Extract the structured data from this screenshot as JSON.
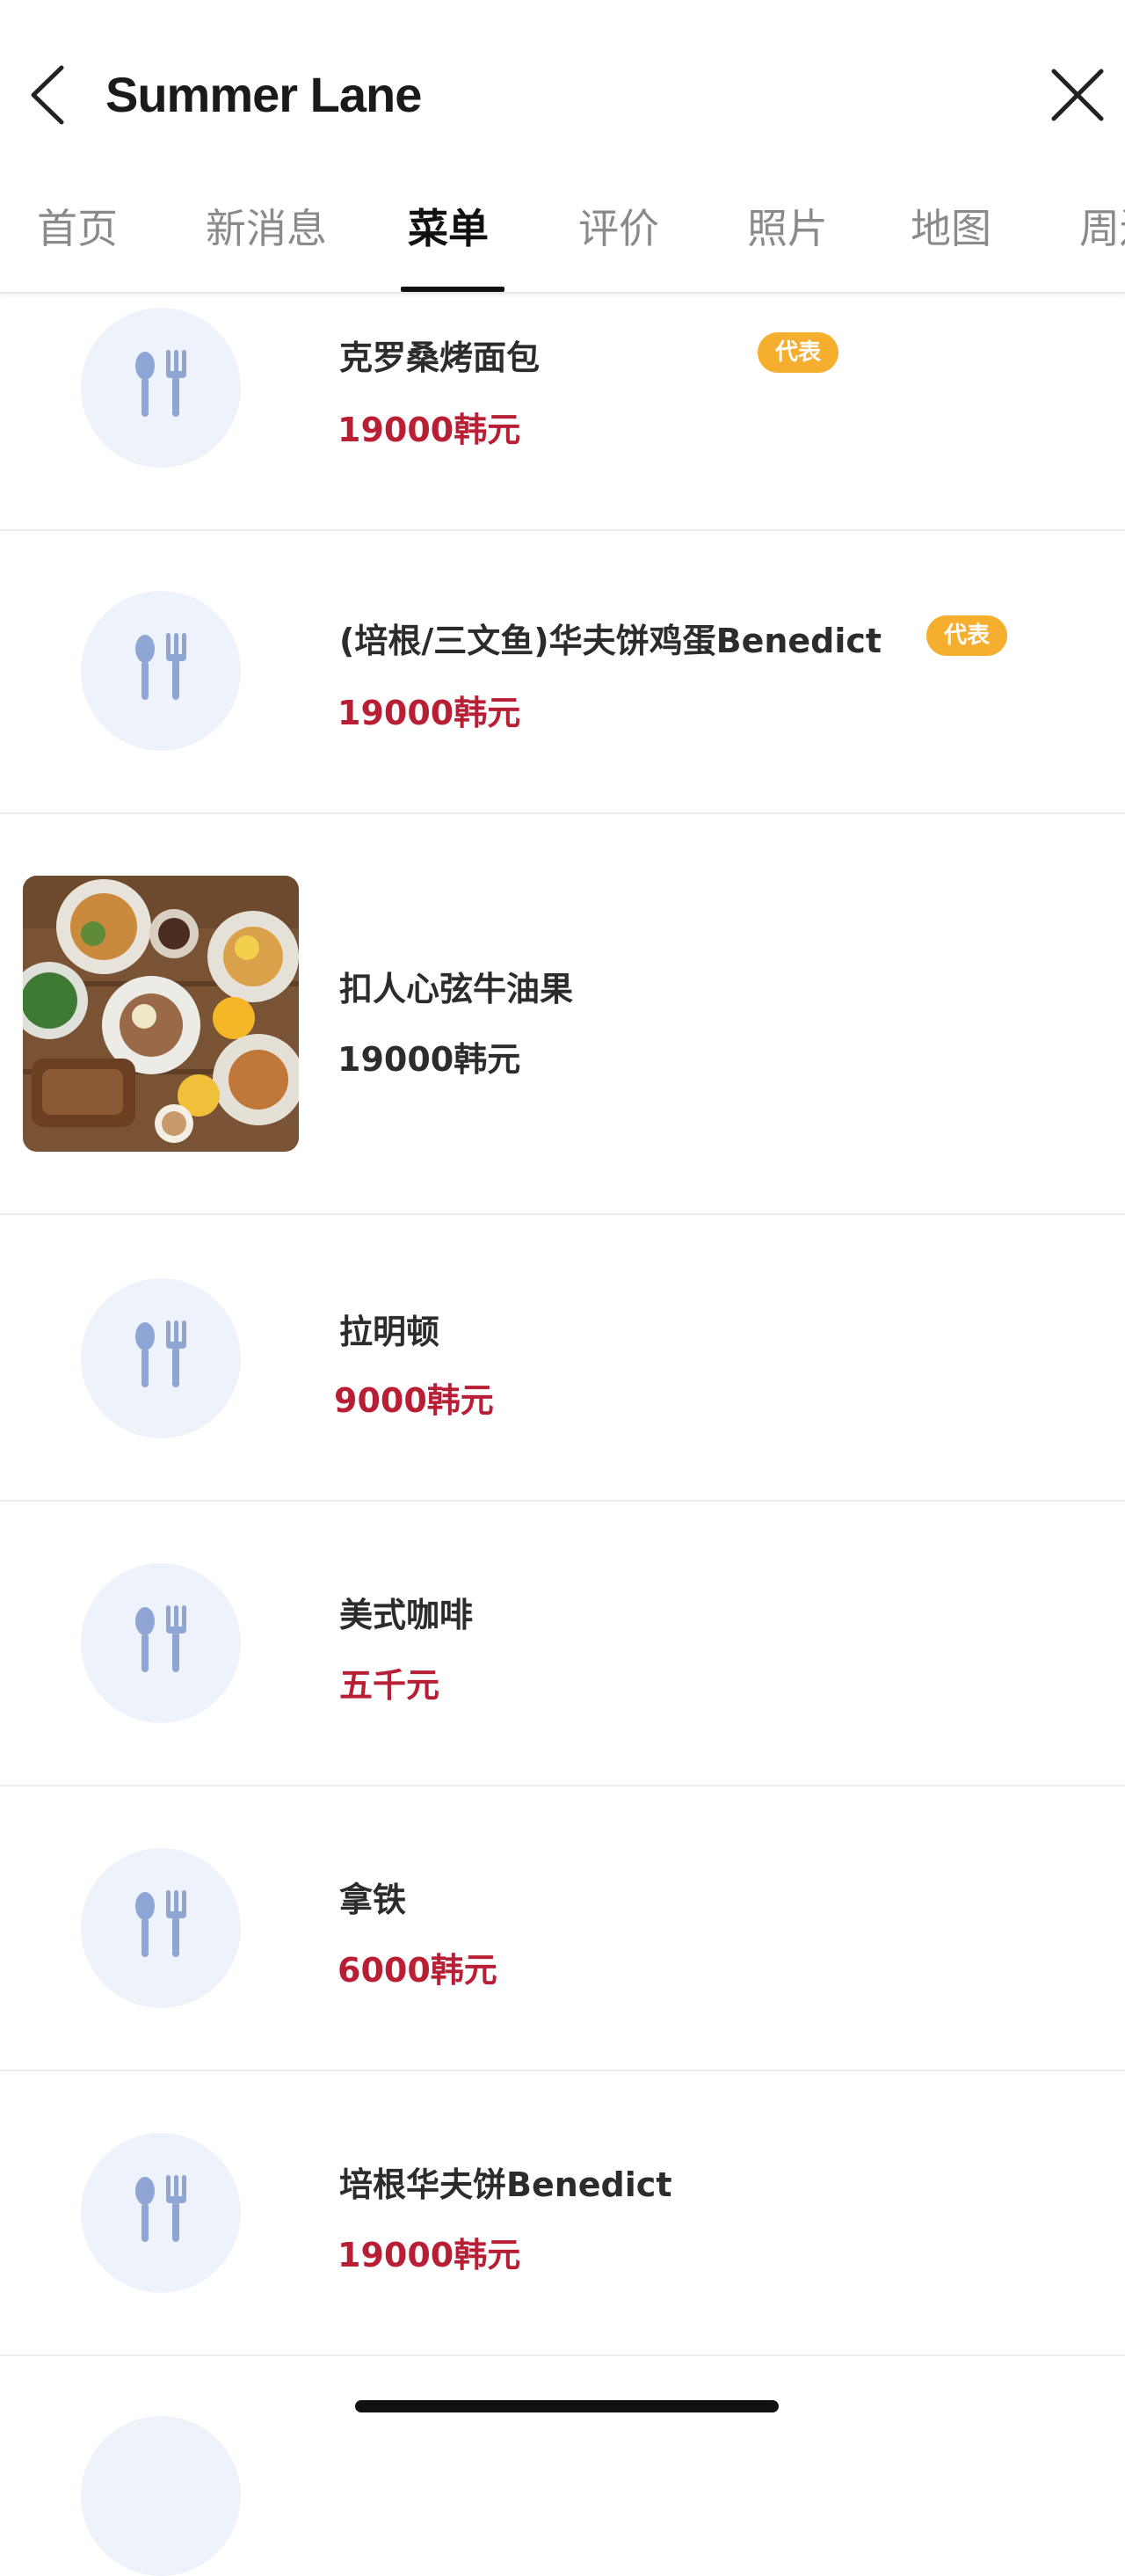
{
  "header": {
    "title": "Summer Lane",
    "back_icon": "chevron-left-icon",
    "close_icon": "close-icon"
  },
  "tabs": [
    {
      "label": "首页"
    },
    {
      "label": "新消息"
    },
    {
      "label": "菜单"
    },
    {
      "label": "评价"
    },
    {
      "label": "照片"
    },
    {
      "label": "地图"
    },
    {
      "label": "周边"
    }
  ],
  "active_tab": "菜单",
  "menu": {
    "items": [
      {
        "name": "克罗桑烤面包",
        "price": "19000韩元",
        "badge": "代表",
        "image": "utensils-placeholder-icon"
      },
      {
        "name": "(培根/三文鱼)华夫饼鸡蛋Benedict",
        "price": "19000韩元",
        "badge": "代表",
        "image": "utensils-placeholder-icon"
      },
      {
        "name": "扣人心弦牛油果",
        "price": "19000韩元",
        "image": "food-photo"
      },
      {
        "name": "拉明顿",
        "price": "9000韩元",
        "image": "utensils-placeholder-icon"
      },
      {
        "name": "美式咖啡",
        "price": "五千元",
        "image": "utensils-placeholder-icon"
      },
      {
        "name": "拿铁",
        "price": "6000韩元",
        "image": "utensils-placeholder-icon"
      },
      {
        "name": "培根华夫饼Benedict",
        "price": "19000韩元",
        "image": "utensils-placeholder-icon"
      }
    ]
  },
  "colors": {
    "price": "#b81f35",
    "badge": "#f5ae2e",
    "placeholder_bg": "#eef3fb",
    "utensil": "#8fa6d4"
  }
}
